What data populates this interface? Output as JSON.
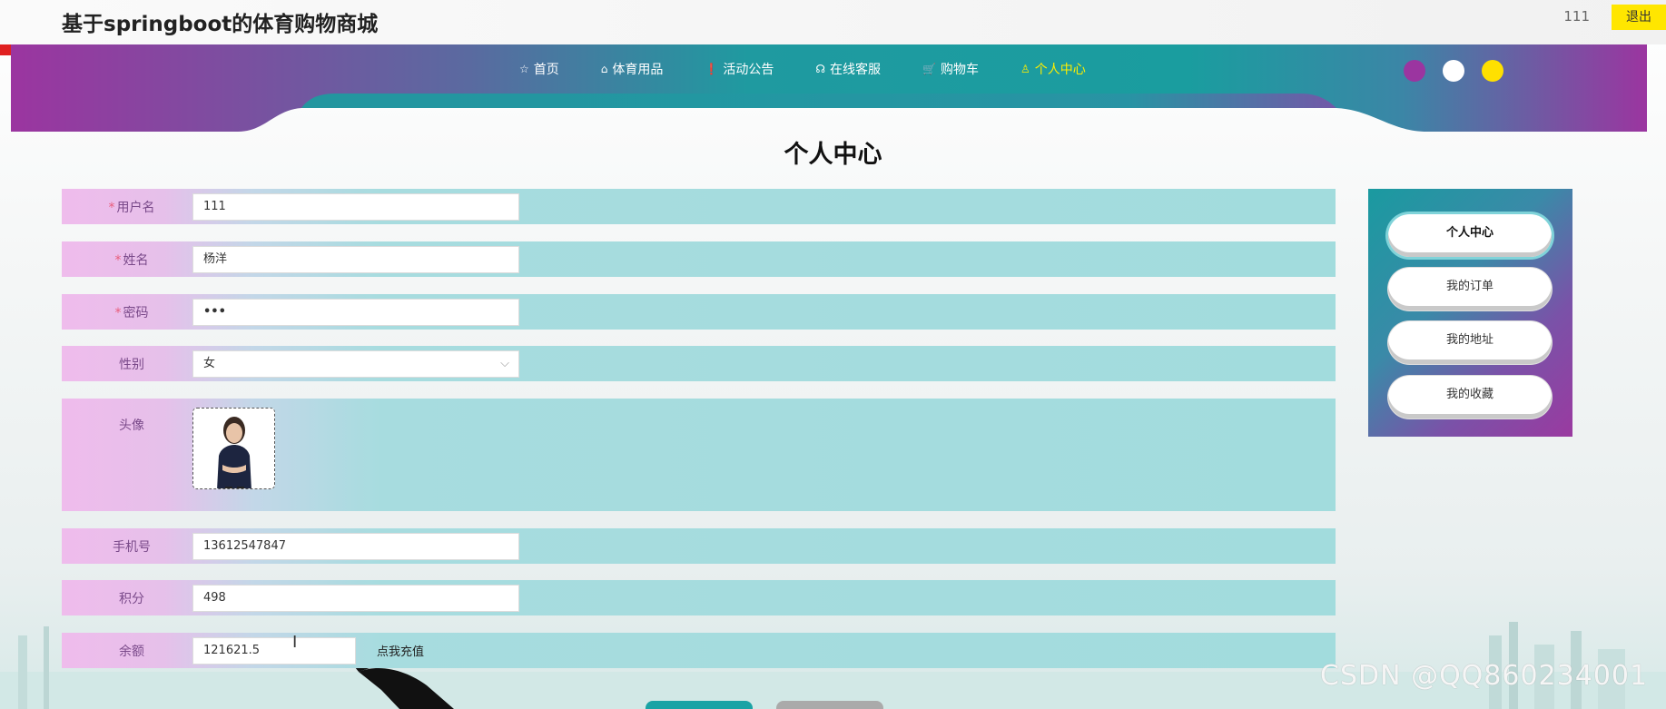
{
  "header": {
    "site_title": "基于springboot的体育购物商城",
    "user_name": "111",
    "logout_label": "退出"
  },
  "nav": {
    "items": [
      {
        "icon": "star-icon",
        "glyph": "☆",
        "label": "首页"
      },
      {
        "icon": "bag-icon",
        "glyph": "⌂",
        "label": "体育用品"
      },
      {
        "icon": "info-icon",
        "glyph": "❗",
        "label": "活动公告"
      },
      {
        "icon": "headset-icon",
        "glyph": "☊",
        "label": "在线客服"
      },
      {
        "icon": "cart-icon",
        "glyph": "🛒",
        "label": "购物车"
      },
      {
        "icon": "user-icon",
        "glyph": "♙",
        "label": "个人中心"
      }
    ],
    "active_index": 5,
    "theme_colors": [
      "#9b35a0",
      "#ffffff",
      "#ffe000"
    ]
  },
  "page": {
    "heading": "个人中心"
  },
  "form": {
    "username": {
      "label": "用户名",
      "value": "111",
      "required": true
    },
    "name": {
      "label": "姓名",
      "value": "杨洋",
      "required": true
    },
    "password": {
      "label": "密码",
      "value": "•••",
      "required": true
    },
    "gender": {
      "label": "性别",
      "value": "女"
    },
    "avatar": {
      "label": "头像"
    },
    "phone": {
      "label": "手机号",
      "value": "13612547847"
    },
    "points": {
      "label": "积分",
      "value": "498"
    },
    "balance": {
      "label": "余额",
      "value": "121621.5",
      "charge_label": "点我充值"
    }
  },
  "side_menu": {
    "items": [
      "个人中心",
      "我的订单",
      "我的地址",
      "我的收藏"
    ]
  },
  "watermark": "CSDN @QQ860234001",
  "colors": {
    "nav_purple": "#9b35a0",
    "nav_teal": "#1a9d9f",
    "row_teal": "#a2dcdd",
    "row_pink": "#efbcec",
    "logout_yellow": "#ffe600"
  }
}
